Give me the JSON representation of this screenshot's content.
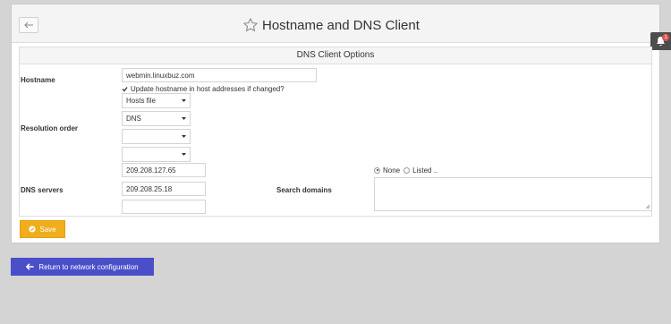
{
  "header": {
    "title": "Hostname and DNS Client",
    "back_icon": "back-arrow-icon",
    "favorite_icon": "star-icon"
  },
  "notification": {
    "icon": "bell-icon",
    "count": "1"
  },
  "form": {
    "title": "DNS Client Options",
    "hostname": {
      "label": "Hostname",
      "value": "webmin.linuxbuz.com",
      "update_checkbox_label": "Update hostname in host addresses if changed?",
      "update_checked": true
    },
    "resolution_order": {
      "label": "Resolution order",
      "selects": [
        "Hosts file",
        "DNS",
        "",
        ""
      ]
    },
    "dns_servers": {
      "label": "DNS servers",
      "values": [
        "209.208.127.65",
        "209.208.25.18",
        ""
      ]
    },
    "search_domains": {
      "label": "Search domains",
      "option_none": "None",
      "option_listed": "Listed ..",
      "selected": "None",
      "value": ""
    }
  },
  "buttons": {
    "save": "Save",
    "return": "Return to network configuration"
  },
  "colors": {
    "save": "#f0ad1c",
    "return": "#4a4fc9",
    "notification_badge": "#d9534f"
  }
}
